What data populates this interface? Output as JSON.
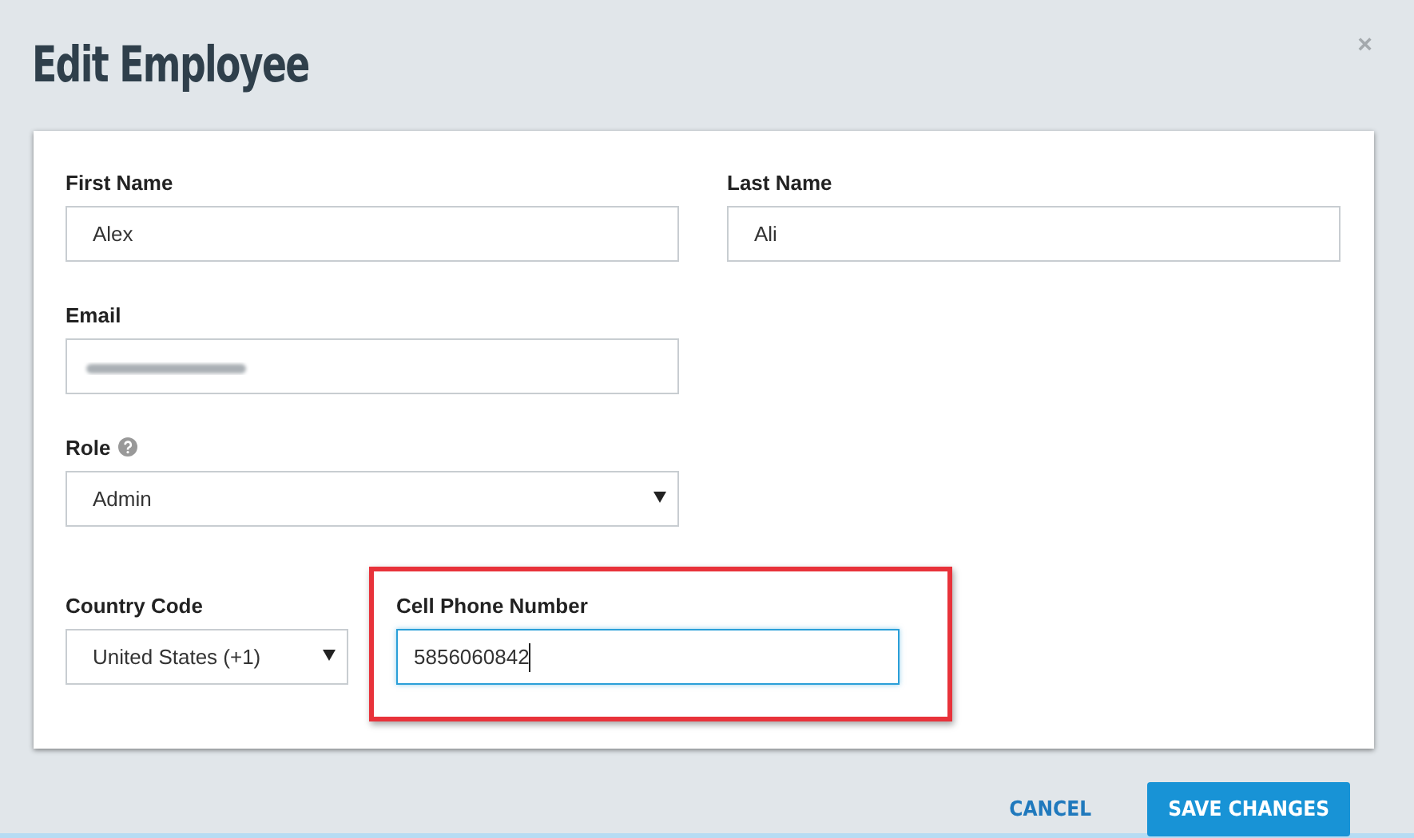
{
  "dialog": {
    "title": "Edit Employee",
    "close": "×"
  },
  "fields": [
    {
      "kind": "text",
      "label": "First Name",
      "value": "Alex"
    },
    {
      "kind": "text",
      "label": "Last Name",
      "value": "Ali"
    },
    {
      "kind": "redacted",
      "label": "Email"
    },
    {
      "kind": "select",
      "label": "Role",
      "value": "Admin",
      "help": true
    },
    {
      "kind": "select",
      "label": "Country Code",
      "value": "United States (+1)"
    },
    {
      "kind": "text",
      "label": "Cell Phone Number",
      "value": "5856060842",
      "focused": true,
      "highlighted": true
    }
  ],
  "buttons": [
    {
      "label": "CANCEL",
      "primary": false
    },
    {
      "label": "SAVE CHANGES",
      "primary": true
    }
  ]
}
